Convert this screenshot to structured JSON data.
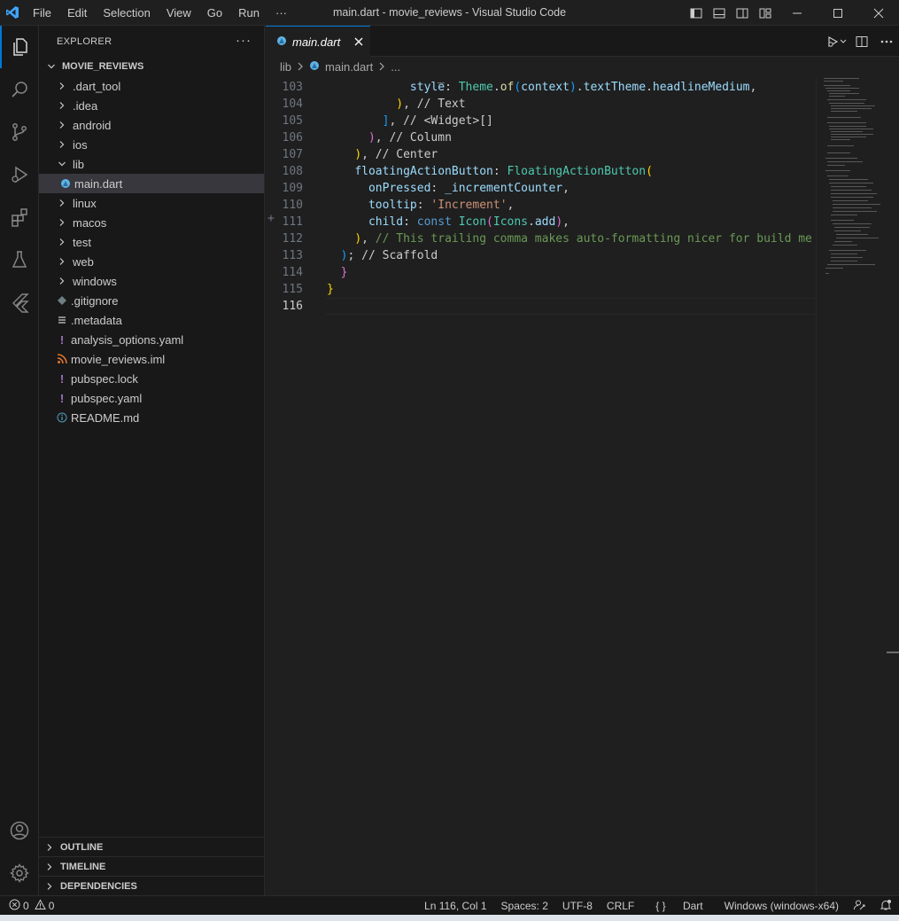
{
  "window": {
    "title": "main.dart - movie_reviews - Visual Studio Code",
    "menu": [
      "File",
      "Edit",
      "Selection",
      "View",
      "Go",
      "Run",
      "···"
    ]
  },
  "sidebar": {
    "header": "EXPLORER",
    "more": "···",
    "root": "MOVIE_REVIEWS",
    "items": [
      {
        "label": ".dart_tool",
        "type": "folder",
        "expanded": false,
        "depth": 1
      },
      {
        "label": ".idea",
        "type": "folder",
        "expanded": false,
        "depth": 1
      },
      {
        "label": "android",
        "type": "folder",
        "expanded": false,
        "depth": 1
      },
      {
        "label": "ios",
        "type": "folder",
        "expanded": false,
        "depth": 1
      },
      {
        "label": "lib",
        "type": "folder",
        "expanded": true,
        "depth": 1
      },
      {
        "label": "main.dart",
        "type": "dart-file",
        "depth": 2,
        "selected": true
      },
      {
        "label": "linux",
        "type": "folder",
        "expanded": false,
        "depth": 1
      },
      {
        "label": "macos",
        "type": "folder",
        "expanded": false,
        "depth": 1
      },
      {
        "label": "test",
        "type": "folder",
        "expanded": false,
        "depth": 1
      },
      {
        "label": "web",
        "type": "folder",
        "expanded": false,
        "depth": 1
      },
      {
        "label": "windows",
        "type": "folder",
        "expanded": false,
        "depth": 1
      },
      {
        "label": ".gitignore",
        "type": "git-file",
        "depth": 1
      },
      {
        "label": ".metadata",
        "type": "text-file",
        "depth": 1
      },
      {
        "label": "analysis_options.yaml",
        "type": "yaml-file",
        "depth": 1
      },
      {
        "label": "movie_reviews.iml",
        "type": "rss-file",
        "depth": 1
      },
      {
        "label": "pubspec.lock",
        "type": "yaml-file",
        "depth": 1
      },
      {
        "label": "pubspec.yaml",
        "type": "yaml-file",
        "depth": 1
      },
      {
        "label": "README.md",
        "type": "info-file",
        "depth": 1
      }
    ],
    "sections": [
      "OUTLINE",
      "TIMELINE",
      "DEPENDENCIES"
    ]
  },
  "editor": {
    "tab_label": "main.dart",
    "breadcrumb": [
      "lib",
      "main.dart",
      "..."
    ],
    "current_line": 116,
    "lines": [
      {
        "n": "103",
        "tokens": [
          [
            "            ",
            ""
          ],
          [
            "style",
            "prop"
          ],
          [
            ": ",
            ""
          ],
          [
            "Theme",
            "cls"
          ],
          [
            ".",
            ""
          ],
          [
            "of",
            "fn"
          ],
          [
            "(",
            "p3"
          ],
          [
            "context",
            "prop"
          ],
          [
            ")",
            "p3"
          ],
          [
            ".",
            ""
          ],
          [
            "textTheme",
            "prop"
          ],
          [
            ".",
            ""
          ],
          [
            "headlineMedium",
            "prop"
          ],
          [
            ",",
            ""
          ]
        ]
      },
      {
        "n": "104",
        "tokens": [
          [
            "          ",
            ""
          ],
          [
            ")",
            "p1"
          ],
          [
            ", ",
            ""
          ],
          [
            "// Text",
            "dim"
          ]
        ]
      },
      {
        "n": "105",
        "tokens": [
          [
            "        ",
            ""
          ],
          [
            "]",
            "p3"
          ],
          [
            ", ",
            ""
          ],
          [
            "// <Widget>[]",
            "dim"
          ]
        ]
      },
      {
        "n": "106",
        "tokens": [
          [
            "      ",
            ""
          ],
          [
            ")",
            "p2"
          ],
          [
            ", ",
            ""
          ],
          [
            "// Column",
            "dim"
          ]
        ]
      },
      {
        "n": "107",
        "tokens": [
          [
            "    ",
            ""
          ],
          [
            ")",
            "p1"
          ],
          [
            ", ",
            ""
          ],
          [
            "// Center",
            "dim"
          ]
        ]
      },
      {
        "n": "108",
        "tokens": [
          [
            "    ",
            ""
          ],
          [
            "floatingActionButton",
            "prop"
          ],
          [
            ": ",
            ""
          ],
          [
            "FloatingActionButton",
            "cls"
          ],
          [
            "(",
            "p1"
          ]
        ]
      },
      {
        "n": "109",
        "tokens": [
          [
            "      ",
            ""
          ],
          [
            "onPressed",
            "prop"
          ],
          [
            ": ",
            ""
          ],
          [
            "_incrementCounter",
            "prop"
          ],
          [
            ",",
            ""
          ]
        ]
      },
      {
        "n": "110",
        "tokens": [
          [
            "      ",
            ""
          ],
          [
            "tooltip",
            "prop"
          ],
          [
            ": ",
            ""
          ],
          [
            "'Increment'",
            "str"
          ],
          [
            ",",
            ""
          ]
        ]
      },
      {
        "n": "111",
        "tokens": [
          [
            "      ",
            ""
          ],
          [
            "child",
            "prop"
          ],
          [
            ": ",
            ""
          ],
          [
            "const ",
            "kw"
          ],
          [
            "Icon",
            "cls"
          ],
          [
            "(",
            "p2"
          ],
          [
            "Icons",
            "cls"
          ],
          [
            ".",
            ""
          ],
          [
            "add",
            "prop"
          ],
          [
            ")",
            "p2"
          ],
          [
            ",",
            ""
          ]
        ]
      },
      {
        "n": "112",
        "tokens": [
          [
            "    ",
            ""
          ],
          [
            ")",
            "p1"
          ],
          [
            ", ",
            ""
          ],
          [
            "// This trailing comma makes auto-formatting nicer for build me",
            "cmt"
          ]
        ]
      },
      {
        "n": "113",
        "tokens": [
          [
            "  ",
            ""
          ],
          [
            ")",
            "p3"
          ],
          [
            "; ",
            ""
          ],
          [
            "// Scaffold",
            "dim"
          ]
        ]
      },
      {
        "n": "114",
        "tokens": [
          [
            "  ",
            ""
          ],
          [
            "}",
            "p2"
          ]
        ]
      },
      {
        "n": "115",
        "tokens": [
          [
            "",
            ""
          ],
          [
            "}",
            "p1"
          ]
        ]
      },
      {
        "n": "116",
        "tokens": [
          [
            "",
            ""
          ]
        ]
      }
    ]
  },
  "statusbar": {
    "errors": "0",
    "warnings": "0",
    "position": "Ln 116, Col 1",
    "spaces": "Spaces: 2",
    "encoding": "UTF-8",
    "eol": "CRLF",
    "language": "Dart",
    "language_icon": "{ }",
    "platform": "Windows (windows-x64)"
  },
  "colors": {
    "accent": "#0078d4",
    "background": "#1f1f1f",
    "sidebar": "#181818",
    "selection": "#37373d"
  }
}
